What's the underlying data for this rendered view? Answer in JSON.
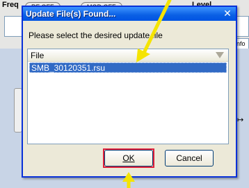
{
  "background": {
    "freq_label": "Freq",
    "buttons": [
      "RF OFF",
      "MOD OFF"
    ],
    "level_label": "Level",
    "info_label": "Info",
    "side_arrow": "↦"
  },
  "dialog": {
    "title": "Update File(s) Found...",
    "close_glyph": "✕",
    "prompt": "Please select the desired update file",
    "list": {
      "column_header": "File",
      "items": [
        "SMB_30120351.rsu"
      ]
    },
    "ok_label": "OK",
    "cancel_label": "Cancel"
  },
  "colors": {
    "titlebar": "#0054e3",
    "selection": "#316ac5",
    "highlight_box": "#e0203a",
    "annotation_arrow": "#f5e400"
  }
}
